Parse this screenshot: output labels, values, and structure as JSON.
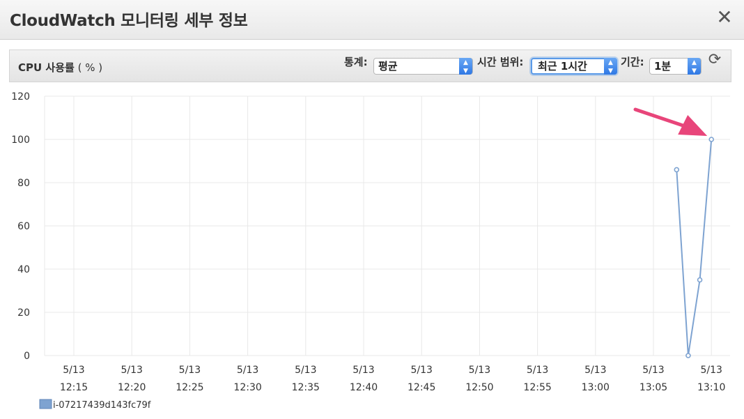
{
  "dialog": {
    "title": "CloudWatch 모니터링 세부 정보",
    "close_icon": "close-icon"
  },
  "panel": {
    "metric_name": "CPU 사용률",
    "metric_unit": " ( % )",
    "statistic_label": "통계:",
    "statistic_value": "평균",
    "range_label": "시간 범위:",
    "range_value": "최근 1시간",
    "period_label": "기간:",
    "period_value": "1분",
    "refresh_icon": "refresh-icon"
  },
  "chart_data": {
    "type": "line",
    "title": "",
    "xlabel": "",
    "ylabel": "",
    "ylim": [
      0,
      120
    ],
    "yticks": [
      0,
      20,
      40,
      60,
      80,
      100,
      120
    ],
    "xtick_labels": [
      [
        "5/13",
        "12:15"
      ],
      [
        "5/13",
        "12:20"
      ],
      [
        "5/13",
        "12:25"
      ],
      [
        "5/13",
        "12:30"
      ],
      [
        "5/13",
        "12:35"
      ],
      [
        "5/13",
        "12:40"
      ],
      [
        "5/13",
        "12:45"
      ],
      [
        "5/13",
        "12:50"
      ],
      [
        "5/13",
        "12:55"
      ],
      [
        "5/13",
        "13:00"
      ],
      [
        "5/13",
        "13:05"
      ],
      [
        "5/13",
        "13:10"
      ]
    ],
    "grid": true,
    "series": [
      {
        "name": "i-07217439d143fc79f",
        "color": "#7ea3d1",
        "x": [
          "13:07",
          "13:08",
          "13:09",
          "13:10"
        ],
        "values": [
          86,
          0,
          35,
          100
        ]
      }
    ],
    "annotation_arrow_color": "#e8457a",
    "legend_position": "bottom-left"
  }
}
